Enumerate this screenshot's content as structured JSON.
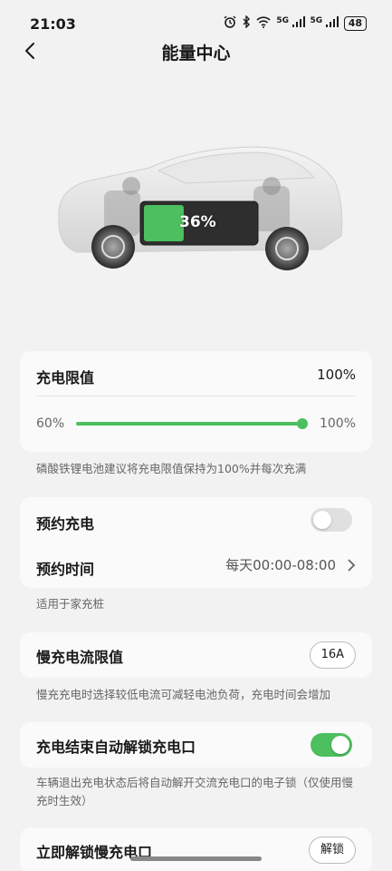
{
  "status": {
    "time": "21:03",
    "network1": "5G",
    "network2": "5G",
    "battery": "48"
  },
  "nav": {
    "title": "能量中心"
  },
  "vehicle": {
    "battery_percent": "36%",
    "battery_level": 0.36
  },
  "charge_limit": {
    "label": "充电限值",
    "value": "100%",
    "min_label": "60%",
    "max_label": "100%",
    "hint": "磷酸铁锂电池建议将充电限值保持为100%并每次充满"
  },
  "schedule": {
    "label": "预约充电",
    "enabled": false,
    "time_label": "预约时间",
    "time_value": "每天00:00-08:00",
    "hint": "适用于家充桩"
  },
  "slow_current": {
    "label": "慢充电流限值",
    "value": "16A",
    "hint": "慢充充电时选择较低电流可减轻电池负荷，充电时间会增加"
  },
  "auto_unlock": {
    "label": "充电结束自动解锁充电口",
    "enabled": true,
    "hint": "车辆退出充电状态后将自动解开交流充电口的电子锁（仅使用慢充时生效）"
  },
  "unlock_now": {
    "label": "立即解锁慢充电口",
    "button": "解锁"
  },
  "colors": {
    "accent": "#4cbf5f",
    "toggle_off": "#e0e0e0"
  }
}
